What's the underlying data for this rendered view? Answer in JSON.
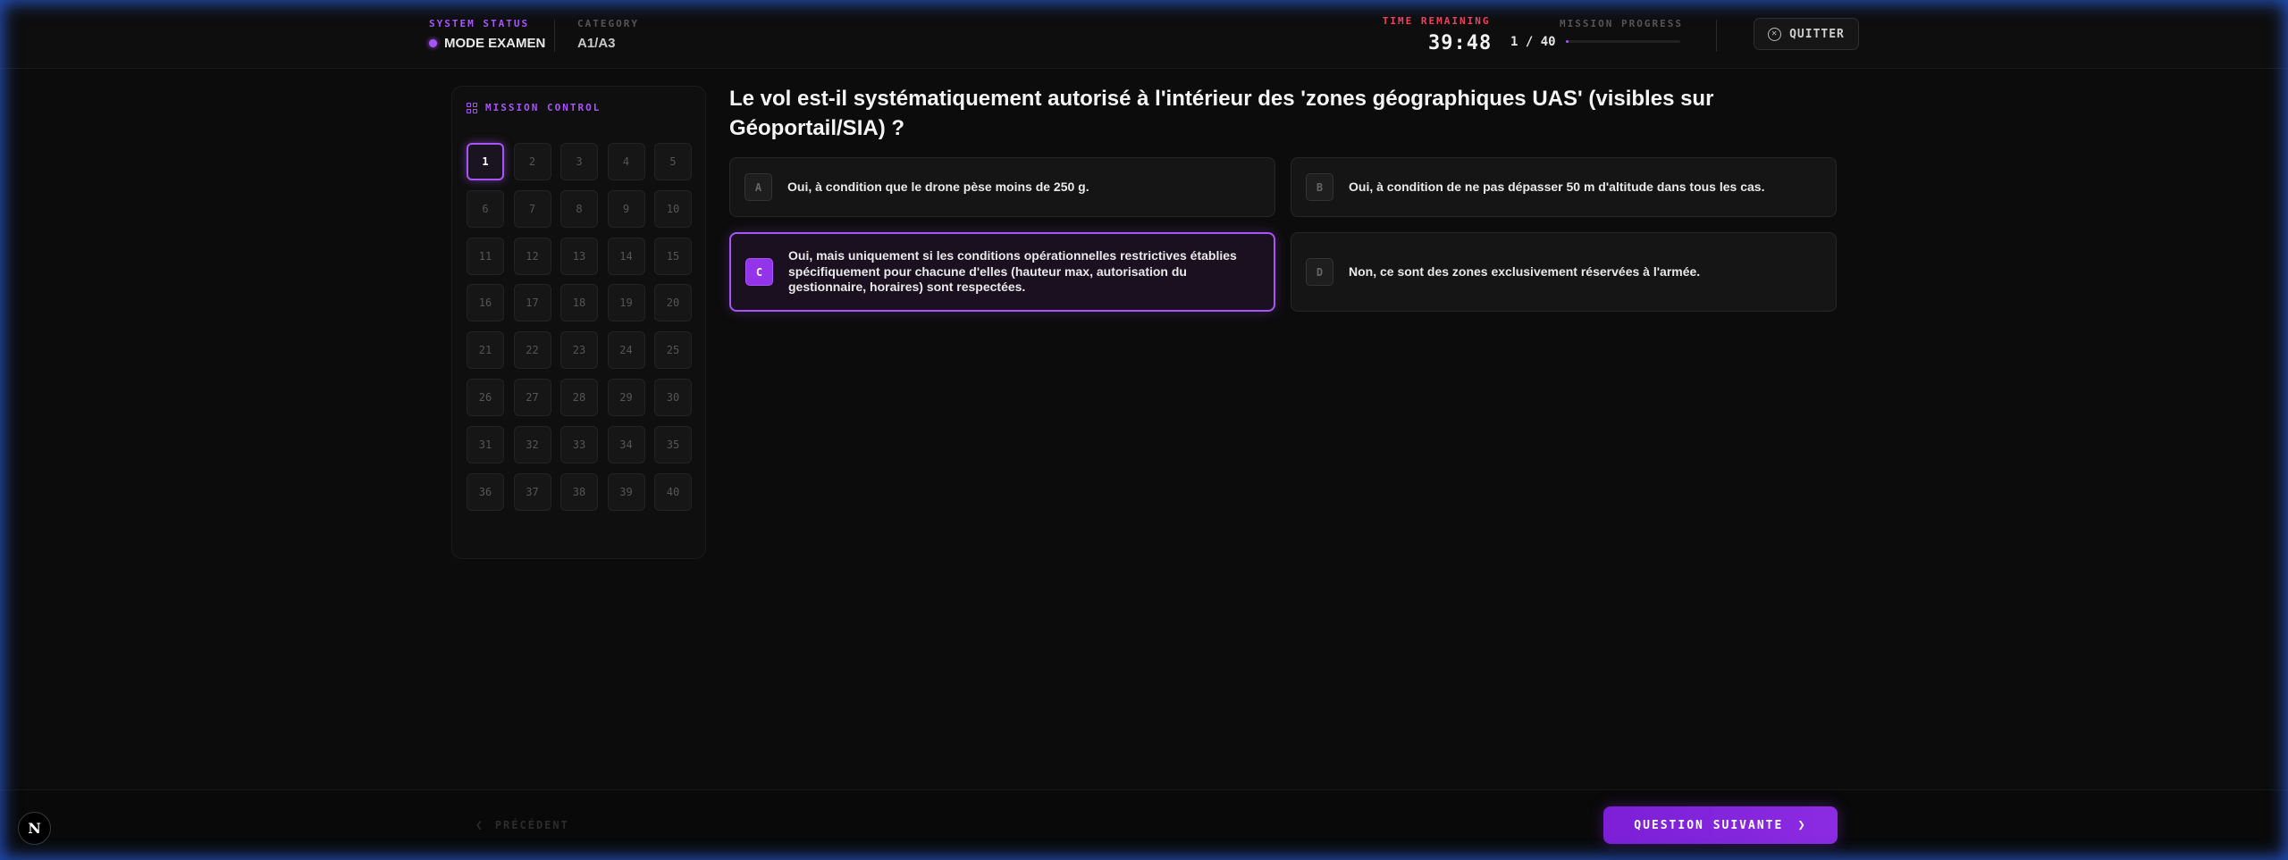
{
  "header": {
    "system_status_label": "SYSTEM STATUS",
    "system_status_value": "MODE EXAMEN",
    "category_label": "CATEGORY",
    "category_value": "A1/A3",
    "time_label": "TIME REMAINING",
    "time_value": "39:48",
    "progress_label": "MISSION PROGRESS",
    "progress_count": "1 / 40",
    "progress_fraction": 0.025,
    "quit_label": "QUITTER"
  },
  "sidebar": {
    "title": "MISSION CONTROL",
    "current_question": 1,
    "questions": [
      "1",
      "2",
      "3",
      "4",
      "5",
      "6",
      "7",
      "8",
      "9",
      "10",
      "11",
      "12",
      "13",
      "14",
      "15",
      "16",
      "17",
      "18",
      "19",
      "20",
      "21",
      "22",
      "23",
      "24",
      "25",
      "26",
      "27",
      "28",
      "29",
      "30",
      "31",
      "32",
      "33",
      "34",
      "35",
      "36",
      "37",
      "38",
      "39",
      "40"
    ]
  },
  "question": {
    "text": "Le vol est-il systématiquement autorisé à l'intérieur des 'zones géographiques UAS' (visibles sur Géoportail/SIA) ?",
    "selected": "C",
    "answers": [
      {
        "letter": "A",
        "text": "Oui, à condition que le drone pèse moins de 250 g."
      },
      {
        "letter": "B",
        "text": "Oui, à condition de ne pas dépasser 50 m d'altitude dans tous les cas."
      },
      {
        "letter": "C",
        "text": "Oui, mais uniquement si les conditions opérationnelles restrictives établies spécifiquement pour chacune d'elles (hauteur max, autorisation du gestionnaire, horaires) sont respectées."
      },
      {
        "letter": "D",
        "text": "Non, ce sont des zones exclusivement réservées à l'armée."
      }
    ]
  },
  "footer": {
    "prev_label": "PRÉCÉDENT",
    "next_label": "QUESTION SUIVANTE",
    "logo_letter": "N"
  },
  "colors": {
    "accent": "#a855f7",
    "timer": "#f43f5e",
    "background": "#0c0c0c"
  }
}
